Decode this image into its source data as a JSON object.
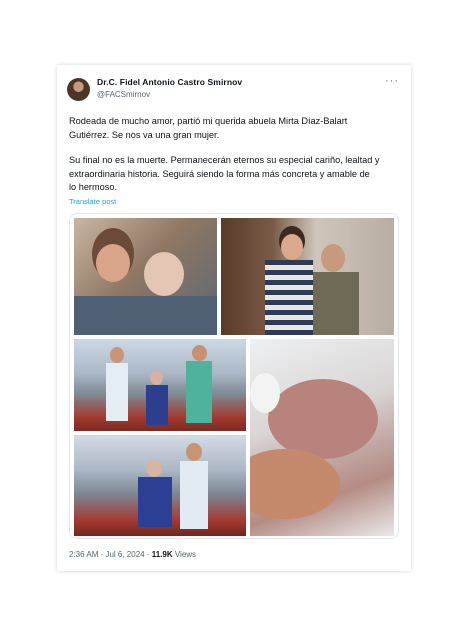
{
  "post": {
    "author_name": "Dr.C. Fidel Antonio Castro Smirnov",
    "handle": "@FACSmirnov",
    "more_label": "···",
    "paragraph_1": "Rodeada de mucho amor, partió mi querida abuela Mirta Díaz-Balart\nGutiérrez. Se nos va una gran mujer.",
    "paragraph_2": "Su final no es la muerte. Permanecerán eternos su especial cariño, lealtad y\nextraordinaria historia. Seguirá siendo la forma más concreta y amable de\nlo hermoso.",
    "translate_label": "Translate post",
    "time": "2:36 AM · Jul 6, 2024 · ",
    "views_count": "11.9K",
    "views_label": " Views"
  },
  "colors": {
    "link": "#1d9bf0",
    "text": "#0f1419",
    "muted": "#536471"
  },
  "photos": [
    "selfie-with-grandmother",
    "dancing-with-woman",
    "three-people-on-balcony",
    "holding-hand",
    "two-people-on-balcony"
  ]
}
